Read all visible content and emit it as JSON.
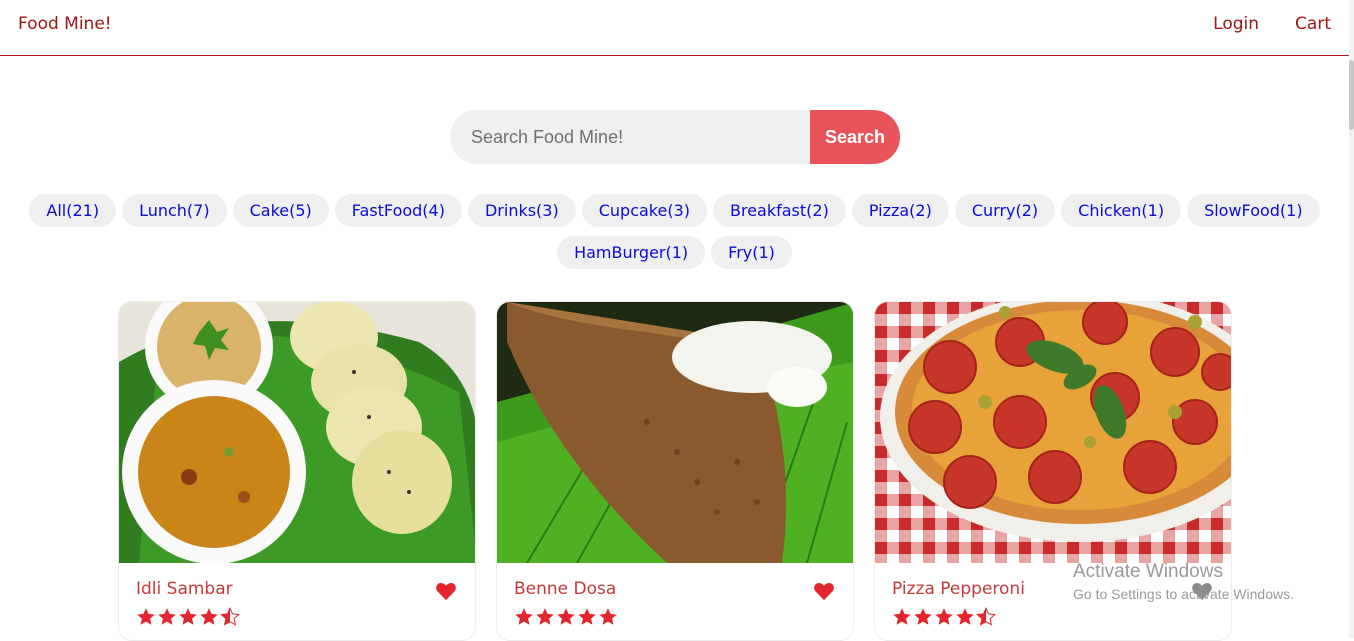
{
  "header": {
    "logo": "Food Mine!",
    "nav": {
      "login": "Login",
      "cart": "Cart"
    },
    "accent_color": "#a11414"
  },
  "search": {
    "placeholder": "Search Food Mine!",
    "button_label": "Search",
    "button_color": "#e9545a"
  },
  "tags": [
    "All(21)",
    "Lunch(7)",
    "Cake(5)",
    "FastFood(4)",
    "Drinks(3)",
    "Cupcake(3)",
    "Breakfast(2)",
    "Pizza(2)",
    "Curry(2)",
    "Chicken(1)",
    "SlowFood(1)",
    "HamBurger(1)",
    "Fry(1)"
  ],
  "foods": [
    {
      "name": "Idli Sambar",
      "stars": 4.5,
      "favorite": true,
      "favorite_color": "#e3262d",
      "image_icon": "idli-sambar-photo"
    },
    {
      "name": "Benne Dosa",
      "stars": 5,
      "favorite": true,
      "favorite_color": "#e3262d",
      "image_icon": "benne-dosa-photo"
    },
    {
      "name": "Pizza Pepperoni",
      "stars": 4.5,
      "favorite": false,
      "favorite_color": "#8a8a8a",
      "image_icon": "pizza-pepperoni-photo"
    }
  ],
  "watermark": {
    "title": "Activate Windows",
    "subtitle": "Go to Settings to activate Windows."
  }
}
